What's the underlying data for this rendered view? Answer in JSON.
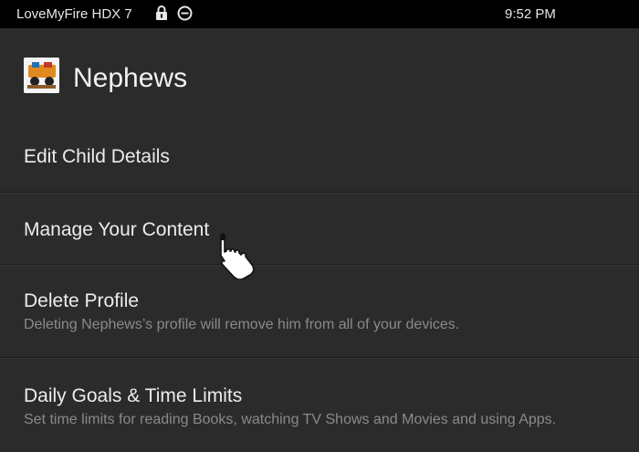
{
  "status_bar": {
    "device_name": "LoveMyFire HDX 7",
    "time": "9:52 PM",
    "icons": [
      "lock-icon",
      "do-not-disturb-icon"
    ]
  },
  "profile": {
    "name": "Nephews",
    "avatar_icon": "child-profile-avatar"
  },
  "menu": {
    "items": [
      {
        "label": "Edit Child Details",
        "description": ""
      },
      {
        "label": "Manage Your Content",
        "description": ""
      },
      {
        "label": "Delete Profile",
        "description": "Deleting Nephews’s profile will remove him from all of your devices."
      },
      {
        "label": "Daily Goals & Time Limits",
        "description": "Set time limits for reading Books, watching TV Shows and Movies and using Apps."
      }
    ]
  },
  "cursor": {
    "icon": "hand-pointer-icon"
  },
  "colors": {
    "background": "#2b2b2b",
    "status_bar": "#000000",
    "text_primary": "#ececec",
    "text_secondary": "#8a8a8a"
  }
}
